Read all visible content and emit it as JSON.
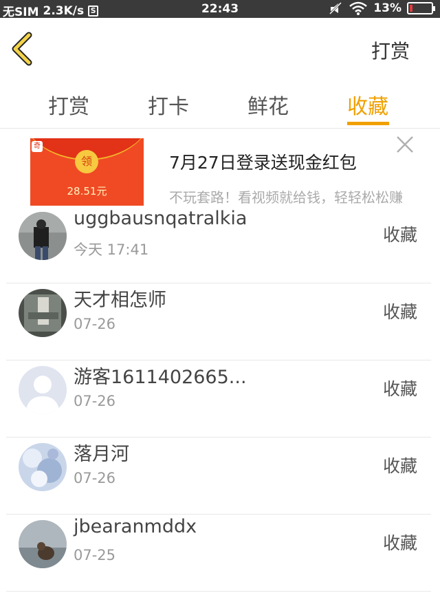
{
  "status_bar": {
    "carrier": "无SIM",
    "speed": "2.3K/s",
    "sim_glyph": "S",
    "time": "22:43",
    "battery": "13%",
    "battery_level": 0.13
  },
  "nav": {
    "right_action": "打赏"
  },
  "tabs": [
    {
      "label": "打赏",
      "active": false
    },
    {
      "label": "打卡",
      "active": false
    },
    {
      "label": "鲜花",
      "active": false
    },
    {
      "label": "收藏",
      "active": true
    }
  ],
  "ad": {
    "title": "7月27日登录送现金红包",
    "subtitle": "不玩套路！看视频就给钱，轻轻松松赚",
    "image_label": "领",
    "image_amount": "28.51元",
    "image_tag": "奇"
  },
  "items": [
    {
      "name": "uggbausnqatralkia",
      "time": "今天 17:41",
      "action": "收藏"
    },
    {
      "name": "天才相怎师",
      "time": "07-26",
      "action": "收藏"
    },
    {
      "name": "游客1611402665...",
      "time": "07-26",
      "action": "收藏"
    },
    {
      "name": "落月河",
      "time": "07-26",
      "action": "收藏"
    },
    {
      "name": "jbearanmddx",
      "time": "07-25",
      "action": "收藏"
    }
  ],
  "colors": {
    "accent": "#f0a000",
    "status_bar": "#3a3a3a",
    "ad_red": "#f04a24"
  }
}
